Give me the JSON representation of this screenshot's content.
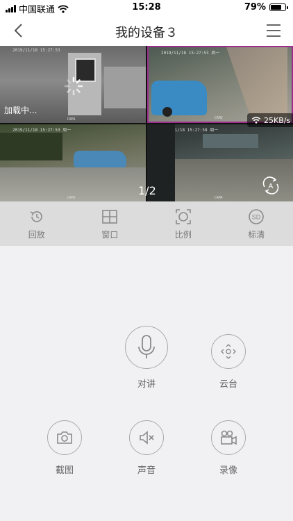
{
  "status_bar": {
    "carrier": "中国联通",
    "time": "15:28",
    "battery_percent": "79%",
    "battery_level": 0.79
  },
  "nav": {
    "title": "我的设备３",
    "back_icon": "chevron-left-icon",
    "menu_icon": "hamburger-menu-icon"
  },
  "video": {
    "loading_text": "加载中...",
    "page_indicator": "1/2",
    "speed": "25KB/s",
    "selected_border_color": "#9b2e8c",
    "tiles": [
      {
        "timestamp": "2019/11/18 15:27:53",
        "cam": "CAM1"
      },
      {
        "timestamp": "2019/11/18 15:27:53 周一",
        "cam": "CAM2"
      },
      {
        "timestamp": "2019/11/18 15:27:53 周一",
        "cam": "CAM3"
      },
      {
        "timestamp": "2019/11/18 15:27:58 周一",
        "cam": "CAM4"
      }
    ]
  },
  "toolbar": {
    "items": [
      {
        "label": "回放",
        "icon": "history-icon"
      },
      {
        "label": "窗口",
        "icon": "grid-window-icon"
      },
      {
        "label": "比例",
        "icon": "aspect-ratio-icon"
      },
      {
        "label": "标清",
        "icon": "sd-quality-icon",
        "badge": "SD"
      }
    ]
  },
  "controls": {
    "intercom": "对讲",
    "ptz": "云台",
    "screenshot": "截图",
    "sound": "声音",
    "record": "录像"
  }
}
